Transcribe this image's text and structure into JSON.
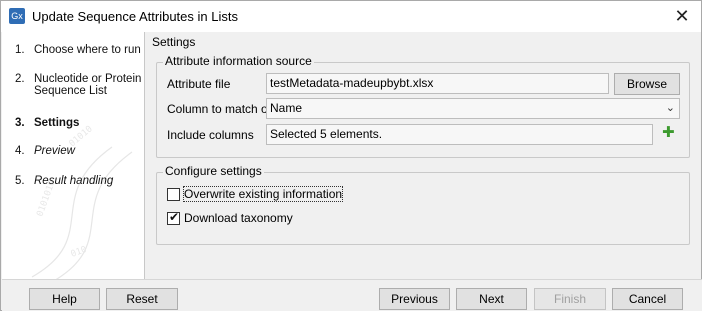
{
  "window": {
    "title": "Update Sequence Attributes in Lists",
    "app_icon": "Gx"
  },
  "steps": [
    {
      "num": "1.",
      "label": "Choose where to run"
    },
    {
      "num": "2.",
      "label": "Nucleotide or Protein Sequence List"
    },
    {
      "num": "3.",
      "label": "Settings"
    },
    {
      "num": "4.",
      "label": "Preview"
    },
    {
      "num": "5.",
      "label": "Result handling"
    }
  ],
  "content": {
    "section_label": "Settings",
    "source_group": {
      "title": "Attribute information source",
      "attribute_file_label": "Attribute file",
      "attribute_file_value": "testMetadata-madeupbybt.xlsx",
      "browse_label": "Browse",
      "column_match_label": "Column to match on",
      "column_match_value": "Name",
      "include_columns_label": "Include columns",
      "include_columns_value": "Selected 5 elements."
    },
    "configure_group": {
      "title": "Configure settings",
      "overwrite_label": "Overwrite existing information",
      "overwrite_checked": false,
      "download_label": "Download taxonomy",
      "download_checked": true
    }
  },
  "footer": {
    "help": "Help",
    "reset": "Reset",
    "previous": "Previous",
    "next": "Next",
    "finish": "Finish",
    "cancel": "Cancel"
  },
  "colors": {
    "accent_plus": "#3c9a2e",
    "app_icon_bg": "#2f6db5"
  }
}
